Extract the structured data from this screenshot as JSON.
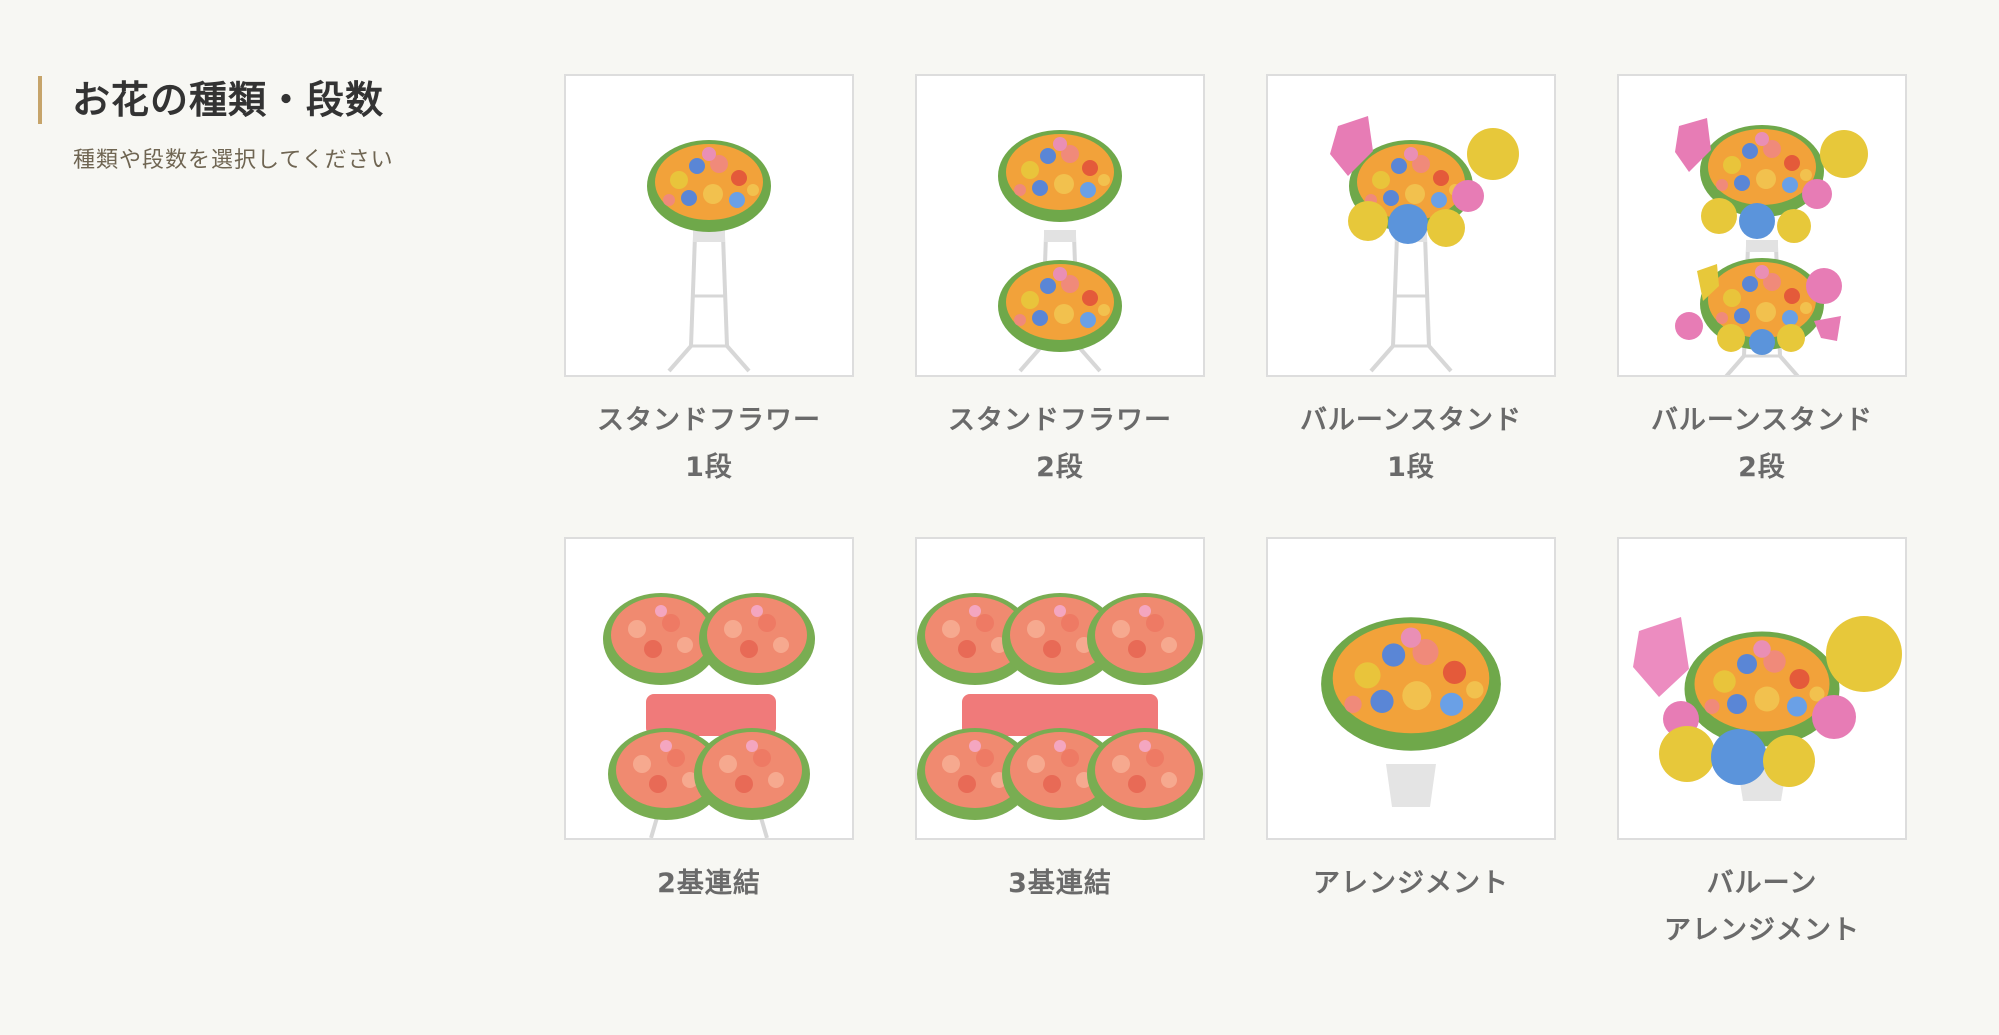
{
  "section": {
    "title": "お花の種類・段数",
    "subtitle": "種類や段数を選択してください"
  },
  "options": [
    {
      "line1": "スタンドフラワー",
      "line2": "1段",
      "icon": "stand-flower-1-tier-icon"
    },
    {
      "line1": "スタンドフラワー",
      "line2": "2段",
      "icon": "stand-flower-2-tier-icon"
    },
    {
      "line1": "バルーンスタンド",
      "line2": "1段",
      "icon": "balloon-stand-1-tier-icon"
    },
    {
      "line1": "バルーンスタンド",
      "line2": "2段",
      "icon": "balloon-stand-2-tier-icon"
    },
    {
      "line1": "2基連結",
      "line2": "",
      "icon": "2-linked-stand-icon"
    },
    {
      "line1": "3基連結",
      "line2": "",
      "icon": "3-linked-stand-icon"
    },
    {
      "line1": "アレンジメント",
      "line2": "",
      "icon": "arrangement-icon"
    },
    {
      "line1": "バルーン",
      "line2": "アレンジメント",
      "icon": "balloon-arrangement-icon"
    }
  ],
  "colors": {
    "accent_bar": "#c6a46a",
    "background": "#f7f7f3",
    "card_border": "#dddddd"
  }
}
